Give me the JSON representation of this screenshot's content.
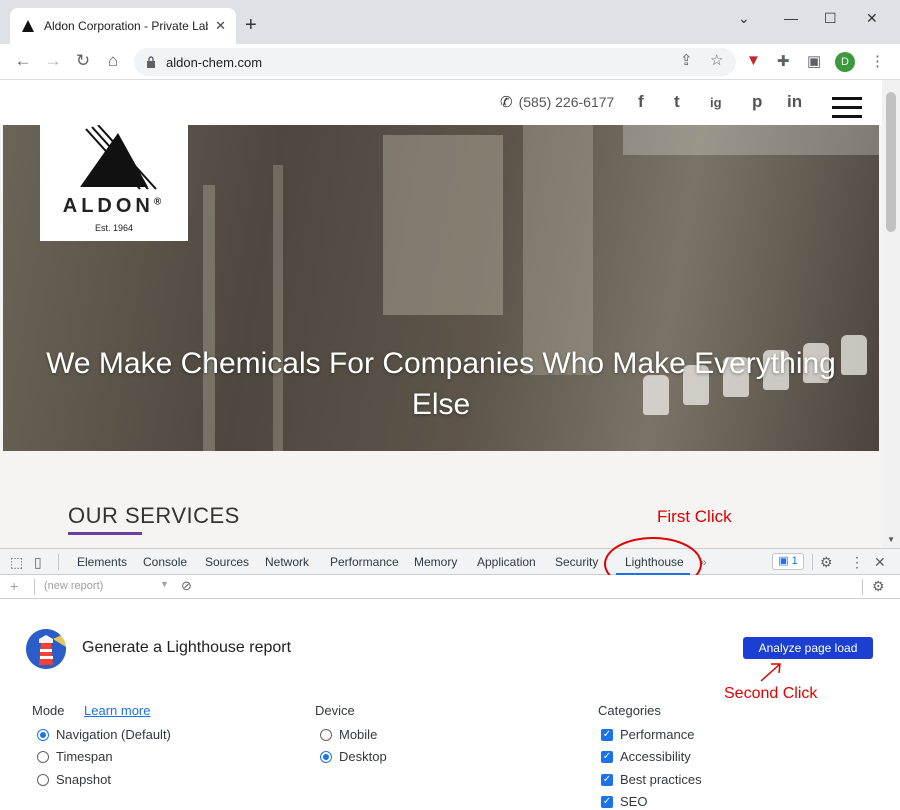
{
  "browser": {
    "tab_title": "Aldon Corporation - Private Labe",
    "tab_close": "✕",
    "new_tab": "+",
    "url": "aldon-chem.com",
    "profile_initial": "D"
  },
  "site": {
    "phone": "(585) 226-6177",
    "social": [
      "f",
      "t",
      "ig",
      "p",
      "in"
    ],
    "logo_name": "ALDON",
    "logo_registered": "®",
    "logo_est": "Est. 1964",
    "hero_line1": "We Make Chemicals For Companies Who Make Everything",
    "hero_line2": "Else",
    "services_title": "OUR SERVICES"
  },
  "annotations": {
    "first": "First Click",
    "second": "Second Click",
    "color": "#e00000"
  },
  "devtools": {
    "tabs": [
      "Elements",
      "Console",
      "Sources",
      "Network",
      "Performance",
      "Memory",
      "Application",
      "Security",
      "Lighthouse"
    ],
    "active_tab": "Lighthouse",
    "more_tabs": "»",
    "issues_count": "1",
    "report_placeholder": "(new report)",
    "add": "+",
    "accent": "#1a73e8"
  },
  "lighthouse": {
    "title": "Generate a Lighthouse report",
    "analyze_button": "Analyze page load",
    "mode_label": "Mode",
    "learn_more": "Learn more",
    "modes": [
      "Navigation (Default)",
      "Timespan",
      "Snapshot"
    ],
    "device_label": "Device",
    "devices": [
      "Mobile",
      "Desktop"
    ],
    "categories_label": "Categories",
    "categories": [
      "Performance",
      "Accessibility",
      "Best practices",
      "SEO"
    ]
  }
}
